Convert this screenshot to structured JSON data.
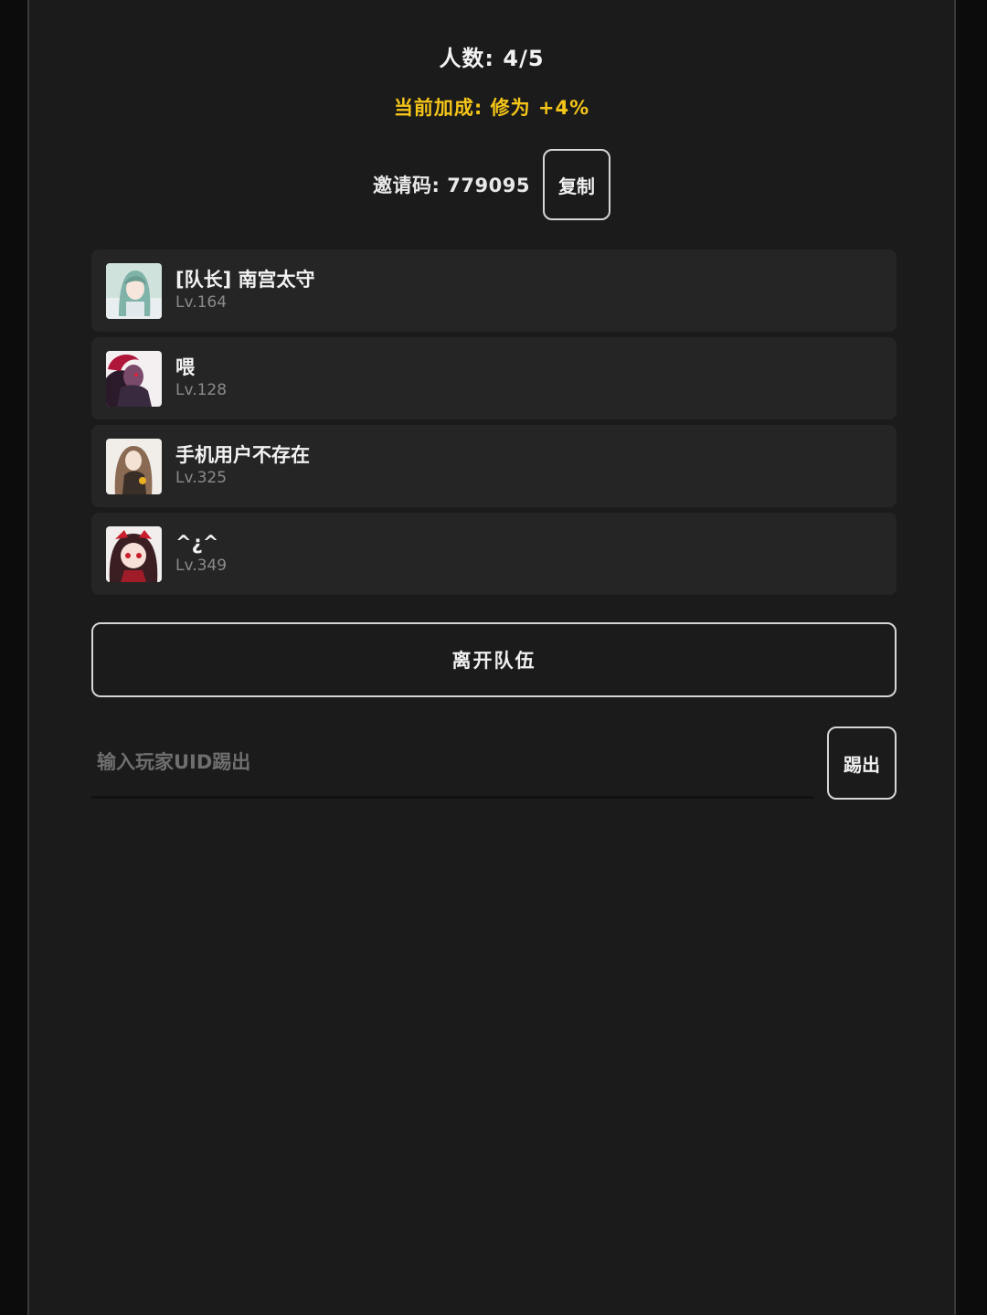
{
  "team": {
    "member_count_text": "人数: 4/5",
    "bonus_text": "当前加成: 修为 +4%",
    "invite_text": "邀请码: 779095",
    "copy_label": "复制"
  },
  "members": [
    {
      "name": "[队长] 南宫太守",
      "level": "Lv.164",
      "avatar": "avatar-teal-hair"
    },
    {
      "name": "喂",
      "level": "Lv.128",
      "avatar": "avatar-red-hair"
    },
    {
      "name": "手机用户不存在",
      "level": "Lv.325",
      "avatar": "avatar-brown-hair"
    },
    {
      "name": "^¿^",
      "level": "Lv.349",
      "avatar": "avatar-dark-hair-red-bow"
    }
  ],
  "actions": {
    "leave_label": "离开队伍",
    "kick_placeholder": "输入玩家UID踢出",
    "kick_label": "踢出"
  },
  "colors": {
    "background": "#1b1b1b",
    "card": "#252525",
    "accent_bonus": "#f5c518",
    "level_text": "#8a8a8a"
  }
}
